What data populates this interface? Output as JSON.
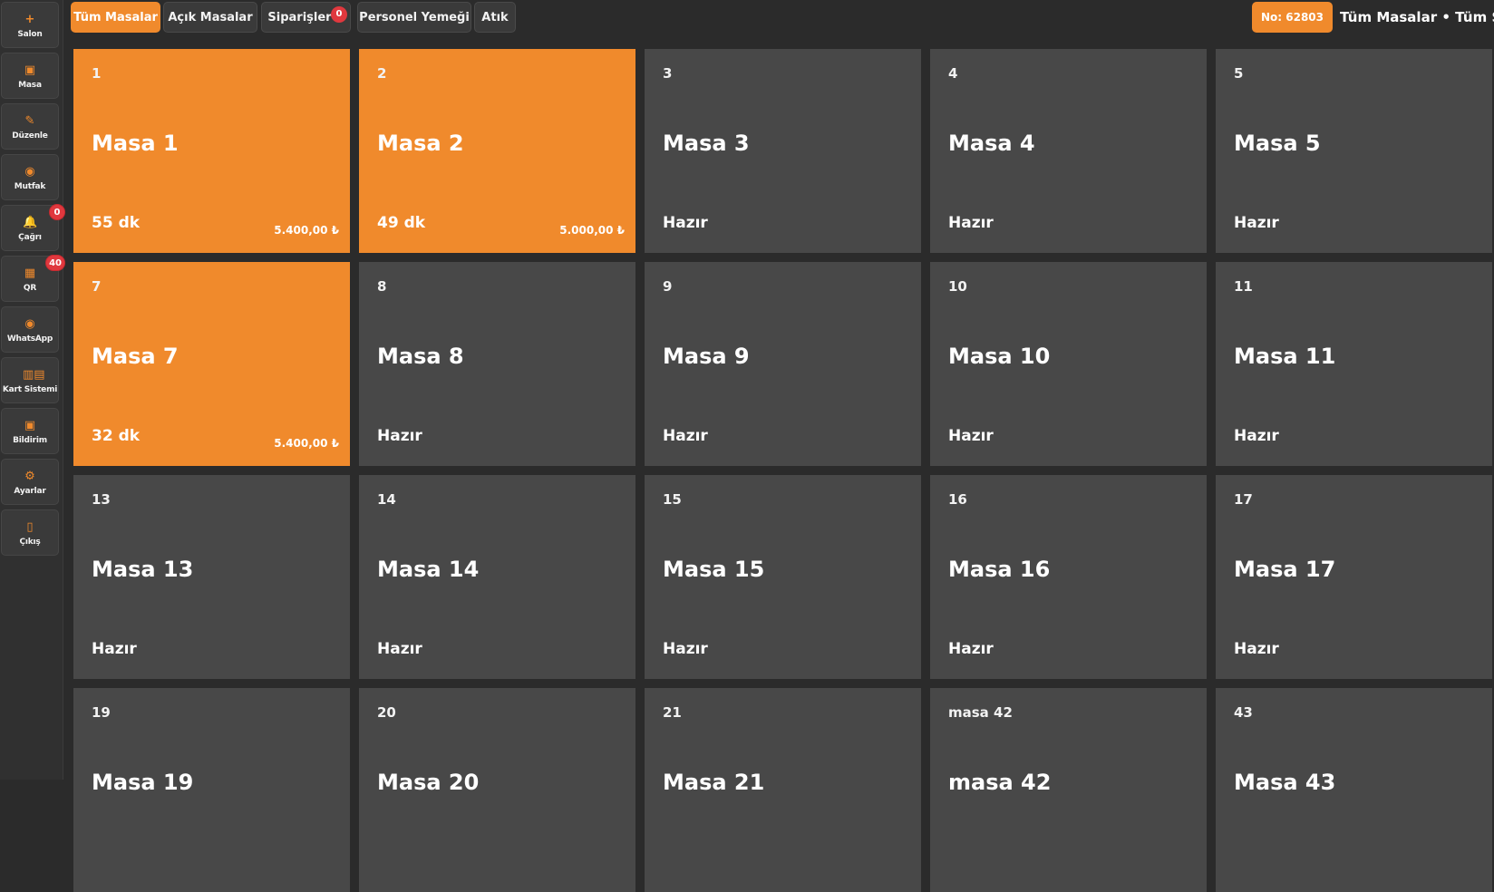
{
  "sidebar": {
    "items": [
      {
        "label": "Salon",
        "icon": "plus-icon",
        "glyph": "+"
      },
      {
        "label": "Masa",
        "icon": "table-icon",
        "glyph": "▣"
      },
      {
        "label": "Düzenle",
        "icon": "pencil-icon",
        "glyph": "✎"
      },
      {
        "label": "Mutfak",
        "icon": "kitchen-icon",
        "glyph": "◉"
      },
      {
        "label": "Çağrı",
        "icon": "bell-icon",
        "glyph": "🔔",
        "badge": "0"
      },
      {
        "label": "QR",
        "icon": "qr-icon",
        "glyph": "▦",
        "badge": "40"
      },
      {
        "label": "WhatsApp",
        "icon": "whatsapp-icon",
        "glyph": "◉"
      },
      {
        "label": "Kart Sistemi",
        "icon": "barcode-icon",
        "glyph": "▥▤"
      },
      {
        "label": "Bildirim",
        "icon": "notification-icon",
        "glyph": "▣"
      },
      {
        "label": "Ayarlar",
        "icon": "gear-icon",
        "glyph": "⚙"
      },
      {
        "label": "Çıkış",
        "icon": "exit-icon",
        "glyph": "▯"
      }
    ]
  },
  "topbar": {
    "tabs": [
      {
        "label": "Tüm Masalar",
        "active": true
      },
      {
        "label": "Açık Masalar"
      },
      {
        "label": "Siparişler",
        "badge": "0"
      },
      {
        "label": "Personel Yemeği"
      },
      {
        "label": "Atık"
      }
    ],
    "order_no": "No: 62803",
    "context": "Tüm Masalar • Tüm Salonlar •"
  },
  "tables": [
    {
      "num": "1",
      "name": "Masa 1",
      "status": "55 dk",
      "amount": "5.400,00 ₺",
      "occupied": true
    },
    {
      "num": "2",
      "name": "Masa 2",
      "status": "49 dk",
      "amount": "5.000,00 ₺",
      "occupied": true
    },
    {
      "num": "3",
      "name": "Masa 3",
      "status": "Hazır"
    },
    {
      "num": "4",
      "name": "Masa 4",
      "status": "Hazır"
    },
    {
      "num": "5",
      "name": "Masa 5",
      "status": "Hazır"
    },
    {
      "num": "7",
      "name": "Masa 7",
      "status": "32 dk",
      "amount": "5.400,00 ₺",
      "occupied": true
    },
    {
      "num": "8",
      "name": "Masa 8",
      "status": "Hazır"
    },
    {
      "num": "9",
      "name": "Masa 9",
      "status": "Hazır"
    },
    {
      "num": "10",
      "name": "Masa 10",
      "status": "Hazır"
    },
    {
      "num": "11",
      "name": "Masa 11",
      "status": "Hazır"
    },
    {
      "num": "13",
      "name": "Masa 13",
      "status": "Hazır"
    },
    {
      "num": "14",
      "name": "Masa 14",
      "status": "Hazır"
    },
    {
      "num": "15",
      "name": "Masa 15",
      "status": "Hazır"
    },
    {
      "num": "16",
      "name": "Masa 16",
      "status": "Hazır"
    },
    {
      "num": "17",
      "name": "Masa 17",
      "status": "Hazır"
    },
    {
      "num": "19",
      "name": "Masa 19",
      "status": ""
    },
    {
      "num": "20",
      "name": "Masa 20",
      "status": ""
    },
    {
      "num": "21",
      "name": "Masa 21",
      "status": ""
    },
    {
      "num": "masa 42",
      "name": "masa 42",
      "status": ""
    },
    {
      "num": "43",
      "name": "Masa 43",
      "status": ""
    }
  ],
  "colors": {
    "accent": "#f08a2c",
    "card": "#484848",
    "badge": "#e0383e",
    "background": "#2b2b2b"
  }
}
